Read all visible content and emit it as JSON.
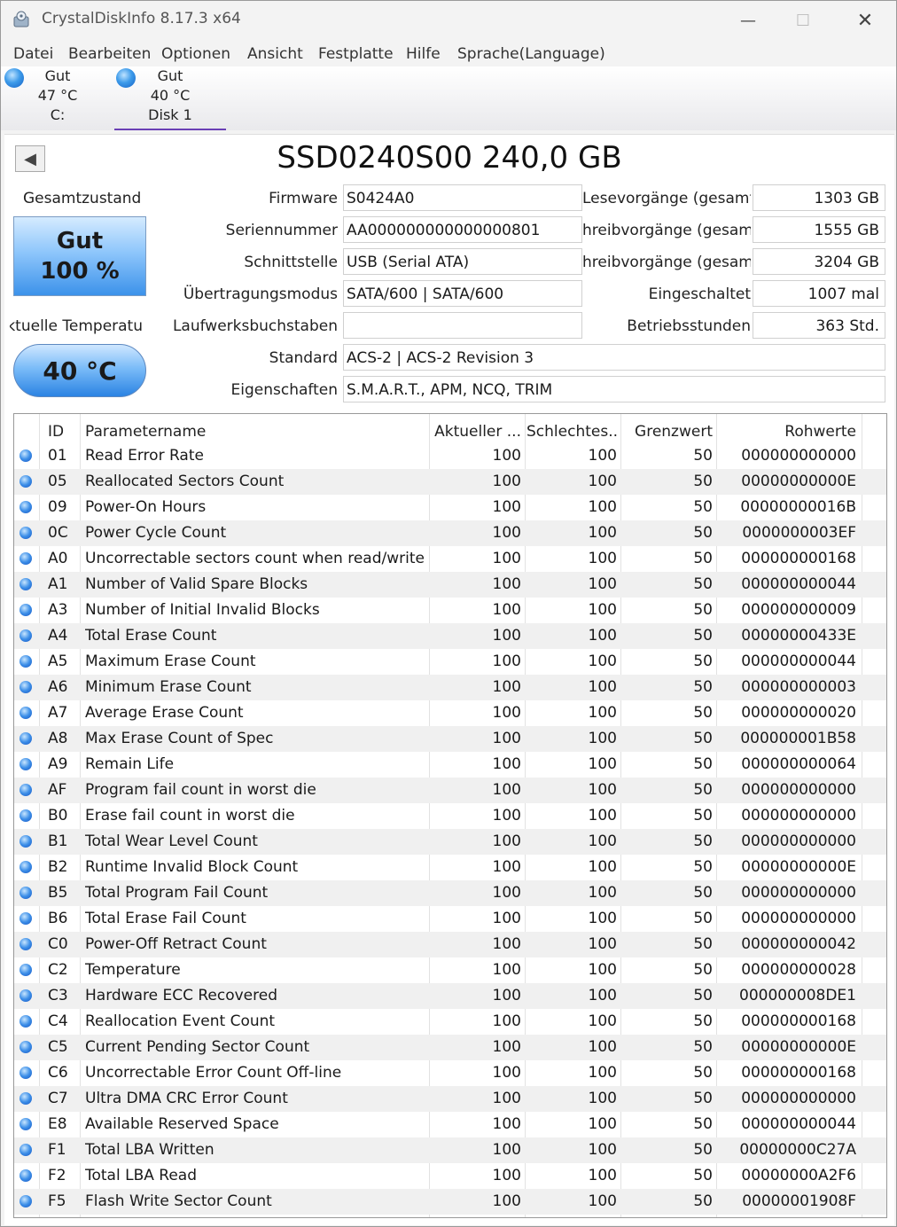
{
  "window": {
    "title": "CrystalDiskInfo 8.17.3 x64"
  },
  "menu": [
    "Datei",
    "Bearbeiten",
    "Optionen",
    "Ansicht",
    "Festplatte",
    "Hilfe",
    "Sprache(Language)"
  ],
  "disks": [
    {
      "status": "Gut",
      "temp": "47 °C",
      "name": "C:"
    },
    {
      "status": "Gut",
      "temp": "40 °C",
      "name": "Disk 1"
    }
  ],
  "drive": {
    "model": "SSD0240S00 240,0 GB",
    "health_label": "Gesamtzustand",
    "health_status": "Gut",
    "health_percent": "100 %",
    "temp_label": "Aktuelle Temperatu",
    "temp_value": "40 °C",
    "info_left": [
      {
        "label": "Firmware",
        "value": "S0424A0"
      },
      {
        "label": "Seriennummer",
        "value": "AA000000000000000801"
      },
      {
        "label": "Schnittstelle",
        "value": "USB (Serial ATA)"
      },
      {
        "label": "Übertragungsmodus",
        "value": "SATA/600 | SATA/600"
      },
      {
        "label": "Laufwerksbuchstaben",
        "value": ""
      }
    ],
    "info_right": [
      {
        "label": "Lesevorgänge (gesamt)",
        "value": "1303 GB"
      },
      {
        "label": "hreibvorgänge (gesamt)",
        "value": "1555 GB"
      },
      {
        "label": "hreibvorgänge (gesamt)",
        "value": "3204 GB"
      },
      {
        "label": "Eingeschaltet",
        "value": "1007 mal"
      },
      {
        "label": "Betriebsstunden",
        "value": "363 Std."
      }
    ],
    "info_wide": [
      {
        "label": "Standard",
        "value": "ACS-2 | ACS-2 Revision 3"
      },
      {
        "label": "Eigenschaften",
        "value": "S.M.A.R.T., APM, NCQ, TRIM"
      }
    ]
  },
  "smart": {
    "headers": [
      "ID",
      "Parametername",
      "Aktueller ...",
      "Schlechtes...",
      "Grenzwert",
      "Rohwerte"
    ],
    "rows": [
      [
        "01",
        "Read Error Rate",
        "100",
        "100",
        "50",
        "000000000000"
      ],
      [
        "05",
        "Reallocated Sectors Count",
        "100",
        "100",
        "50",
        "00000000000E"
      ],
      [
        "09",
        "Power-On Hours",
        "100",
        "100",
        "50",
        "00000000016B"
      ],
      [
        "0C",
        "Power Cycle Count",
        "100",
        "100",
        "50",
        "0000000003EF"
      ],
      [
        "A0",
        "Uncorrectable sectors count when read/write",
        "100",
        "100",
        "50",
        "000000000168"
      ],
      [
        "A1",
        "Number of Valid Spare Blocks",
        "100",
        "100",
        "50",
        "000000000044"
      ],
      [
        "A3",
        "Number of Initial Invalid Blocks",
        "100",
        "100",
        "50",
        "000000000009"
      ],
      [
        "A4",
        "Total Erase Count",
        "100",
        "100",
        "50",
        "00000000433E"
      ],
      [
        "A5",
        "Maximum Erase Count",
        "100",
        "100",
        "50",
        "000000000044"
      ],
      [
        "A6",
        "Minimum Erase Count",
        "100",
        "100",
        "50",
        "000000000003"
      ],
      [
        "A7",
        "Average Erase Count",
        "100",
        "100",
        "50",
        "000000000020"
      ],
      [
        "A8",
        "Max Erase Count of Spec",
        "100",
        "100",
        "50",
        "000000001B58"
      ],
      [
        "A9",
        "Remain Life",
        "100",
        "100",
        "50",
        "000000000064"
      ],
      [
        "AF",
        "Program fail count in worst die",
        "100",
        "100",
        "50",
        "000000000000"
      ],
      [
        "B0",
        "Erase fail count in worst die",
        "100",
        "100",
        "50",
        "000000000000"
      ],
      [
        "B1",
        "Total Wear Level Count",
        "100",
        "100",
        "50",
        "000000000000"
      ],
      [
        "B2",
        "Runtime Invalid Block Count",
        "100",
        "100",
        "50",
        "00000000000E"
      ],
      [
        "B5",
        "Total Program Fail Count",
        "100",
        "100",
        "50",
        "000000000000"
      ],
      [
        "B6",
        "Total Erase Fail Count",
        "100",
        "100",
        "50",
        "000000000000"
      ],
      [
        "C0",
        "Power-Off Retract Count",
        "100",
        "100",
        "50",
        "000000000042"
      ],
      [
        "C2",
        "Temperature",
        "100",
        "100",
        "50",
        "000000000028"
      ],
      [
        "C3",
        "Hardware ECC Recovered",
        "100",
        "100",
        "50",
        "000000008DE1"
      ],
      [
        "C4",
        "Reallocation Event Count",
        "100",
        "100",
        "50",
        "000000000168"
      ],
      [
        "C5",
        "Current Pending Sector Count",
        "100",
        "100",
        "50",
        "00000000000E"
      ],
      [
        "C6",
        "Uncorrectable Error Count Off-line",
        "100",
        "100",
        "50",
        "000000000168"
      ],
      [
        "C7",
        "Ultra DMA CRC Error Count",
        "100",
        "100",
        "50",
        "000000000000"
      ],
      [
        "E8",
        "Available Reserved Space",
        "100",
        "100",
        "50",
        "000000000044"
      ],
      [
        "F1",
        "Total LBA Written",
        "100",
        "100",
        "50",
        "00000000C27A"
      ],
      [
        "F2",
        "Total LBA Read",
        "100",
        "100",
        "50",
        "00000000A2F6"
      ],
      [
        "F5",
        "Flash Write Sector Count",
        "100",
        "100",
        "50",
        "00000001908F"
      ]
    ]
  },
  "colors": {
    "status_good": "#3d9bea",
    "selected_tab_underline": "#6a3fb5"
  }
}
